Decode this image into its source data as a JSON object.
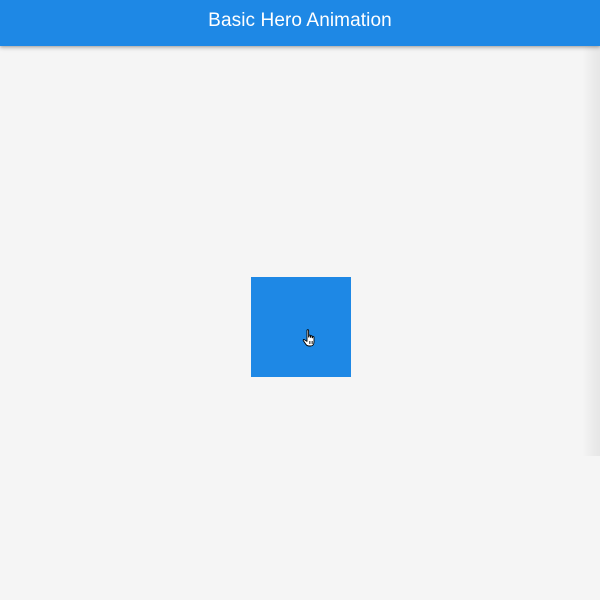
{
  "app_bar": {
    "title": "Basic Hero Animation",
    "color": "#1e88e5",
    "title_color": "#ffffff"
  },
  "body": {
    "background": "#f5f5f5"
  },
  "hero": {
    "color": "#1e88e5",
    "cursor_icon": "hand-pointer-icon"
  }
}
